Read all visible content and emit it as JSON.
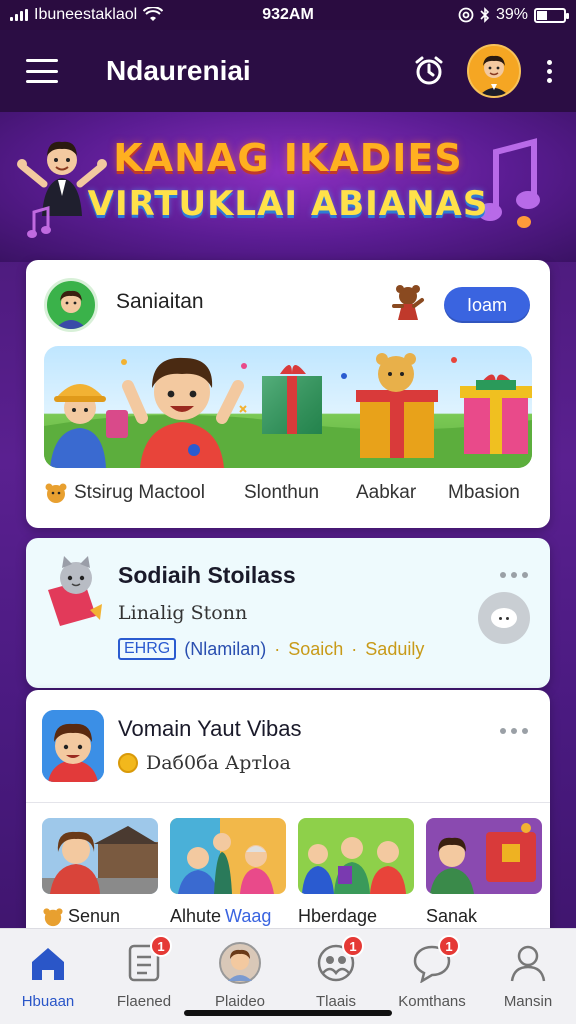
{
  "status_bar": {
    "carrier": "Ibuneestaklaol",
    "time": "932AM",
    "battery": "39%",
    "battery_level": 0.39
  },
  "header": {
    "title": "Ndaureniai",
    "icons": [
      "menu-icon",
      "alarm-icon",
      "avatar",
      "more-vertical-icon"
    ]
  },
  "banner": {
    "title": "KANAG IKADIES",
    "subtitle": "VIRTUKLAI ABIANAS"
  },
  "card1": {
    "name": "Saniaitan",
    "join_label": "Ioam",
    "tabs": [
      "Stsirug Mactool",
      "Slonthun",
      "Aabkar",
      "Mbasion"
    ]
  },
  "card2": {
    "title": "Sodiaih Stoilass",
    "subtitle": "Linalig Stonn",
    "tag_box": "EHRG",
    "tag_paren": "(Nlamilan)",
    "tag_gold_1": "Soaich",
    "tag_gold_2": "Saduily",
    "separator": "·"
  },
  "card3": {
    "title": "Vomain Yaut Vibas",
    "meta": "Dаб0ба Артloa",
    "thumb_labels": [
      {
        "text": "Senun",
        "blue": ""
      },
      {
        "text": "Alhute ",
        "blue": "Waag"
      },
      {
        "text": "Hberdage",
        "blue": ""
      },
      {
        "text": "Sanak",
        "blue": ""
      }
    ]
  },
  "bottom_nav": {
    "items": [
      {
        "label": "Hbuaan",
        "icon": "home-icon",
        "badge": ""
      },
      {
        "label": "Flaened",
        "icon": "document-icon",
        "badge": "1"
      },
      {
        "label": "Plaideo",
        "icon": "profile-photo-icon",
        "badge": ""
      },
      {
        "label": "Tlaais",
        "icon": "people-icon",
        "badge": "1"
      },
      {
        "label": "Komthans",
        "icon": "chat-icon",
        "badge": "1"
      },
      {
        "label": "Mansin",
        "icon": "person-icon",
        "badge": ""
      }
    ]
  },
  "colors": {
    "accent": "#3a64e0",
    "background": "#4b1a7a",
    "badge": "#e53935"
  }
}
